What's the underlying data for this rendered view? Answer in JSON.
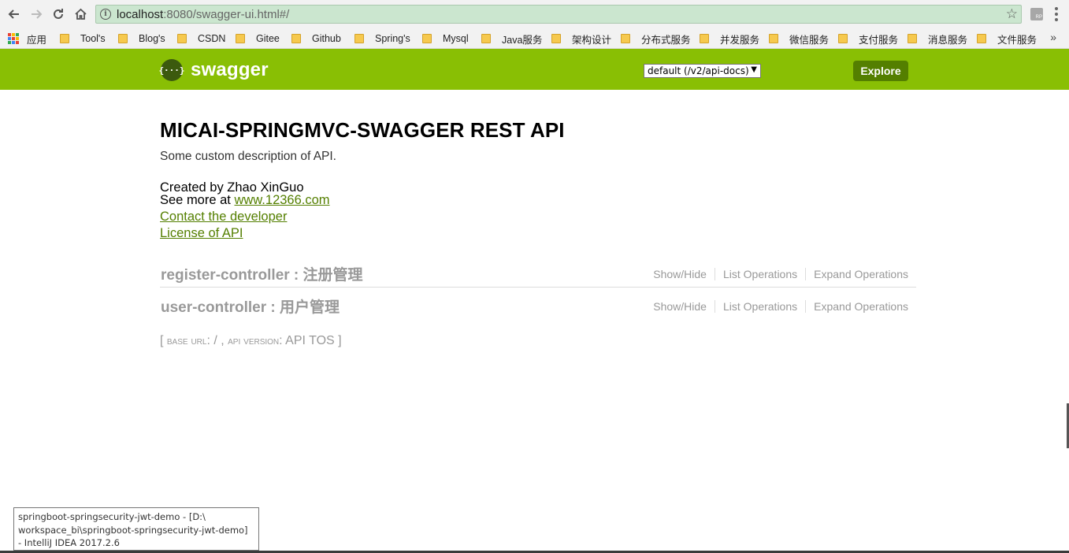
{
  "browser": {
    "url_host": "localhost",
    "url_rest": ":8080/swagger-ui.html#/",
    "ext_label": "RP"
  },
  "bookmarks": {
    "apps_label": "应用",
    "items": [
      "Tool's",
      "Blog's",
      "CSDN",
      "Gitee",
      "Github",
      "Spring's",
      "Mysql",
      "Java服务",
      "架构设计",
      "分布式服务",
      "并发服务",
      "微信服务",
      "支付服务",
      "消息服务",
      "文件服务"
    ],
    "more_label": "»"
  },
  "swagger": {
    "logo_icon_text": "{···}",
    "logo_text": "swagger",
    "select_value": "default (/v2/api-docs)",
    "explore_label": "Explore",
    "brand_color": "#89bf04"
  },
  "api": {
    "title": "MICAI-SPRINGMVC-SWAGGER REST API",
    "description": "Some custom description of API.",
    "created_by": "Created by Zhao XinGuo",
    "see_more_prefix": "See more at ",
    "see_more_link": "www.12366.com",
    "contact_label": "Contact the developer",
    "license_label": "License of API"
  },
  "resources": [
    {
      "name": "register-controller : 注册管理",
      "show_hide": "Show/Hide",
      "list_ops": "List Operations",
      "expand_ops": "Expand Operations"
    },
    {
      "name": "user-controller : 用户管理",
      "show_hide": "Show/Hide",
      "list_ops": "List Operations",
      "expand_ops": "Expand Operations"
    }
  ],
  "footer": {
    "open_bracket": "[ ",
    "base_url_label": "base url",
    "base_url_value": ": / , ",
    "api_version_label": "api version",
    "api_version_value": ": API TOS ",
    "close_bracket": "]"
  },
  "tooltip": {
    "line1": "springboot-springsecurity-jwt-demo - [D:\\",
    "line2": "workspace_bi\\springboot-springsecurity-jwt-demo]",
    "line3": "- IntelliJ IDEA 2017.2.6"
  }
}
